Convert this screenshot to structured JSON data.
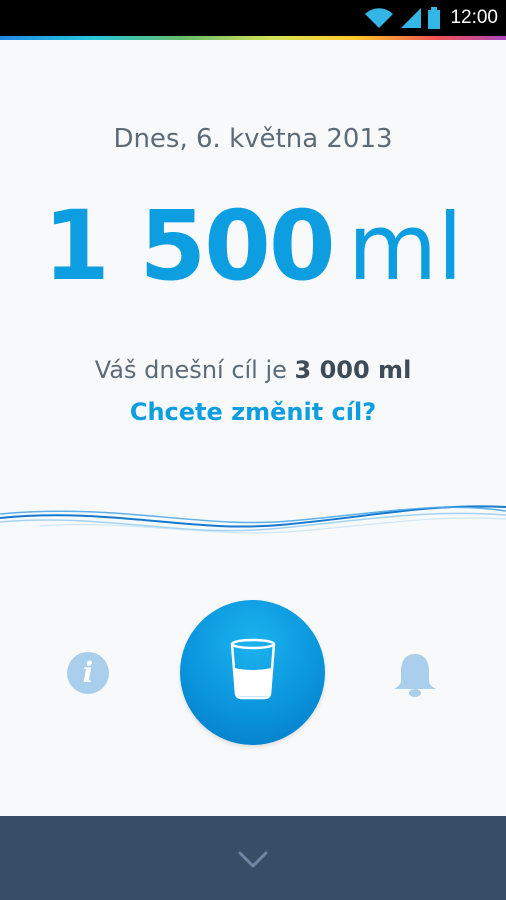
{
  "status_bar": {
    "time": "12:00",
    "icons": [
      "wifi-icon",
      "signal-icon",
      "battery-icon"
    ]
  },
  "main": {
    "date": "Dnes, 6. května 2013",
    "amount_value": "1 500",
    "amount_unit": "ml",
    "goal_prefix": "Váš dnešní cíl je ",
    "goal_value": "3 000 ml",
    "change_goal": "Chcete změnit cíl?"
  },
  "actions": {
    "info_icon": "info-icon",
    "info_glyph": "i",
    "drink_icon": "glass-icon",
    "reminder_icon": "bell-icon"
  },
  "bottom_bar": {
    "icon": "chevron-down-icon"
  },
  "colors": {
    "accent": "#0d9ee1",
    "text_secondary": "#5c6b78",
    "bottom_bar": "#384e66",
    "muted_icon": "#aacfec"
  }
}
